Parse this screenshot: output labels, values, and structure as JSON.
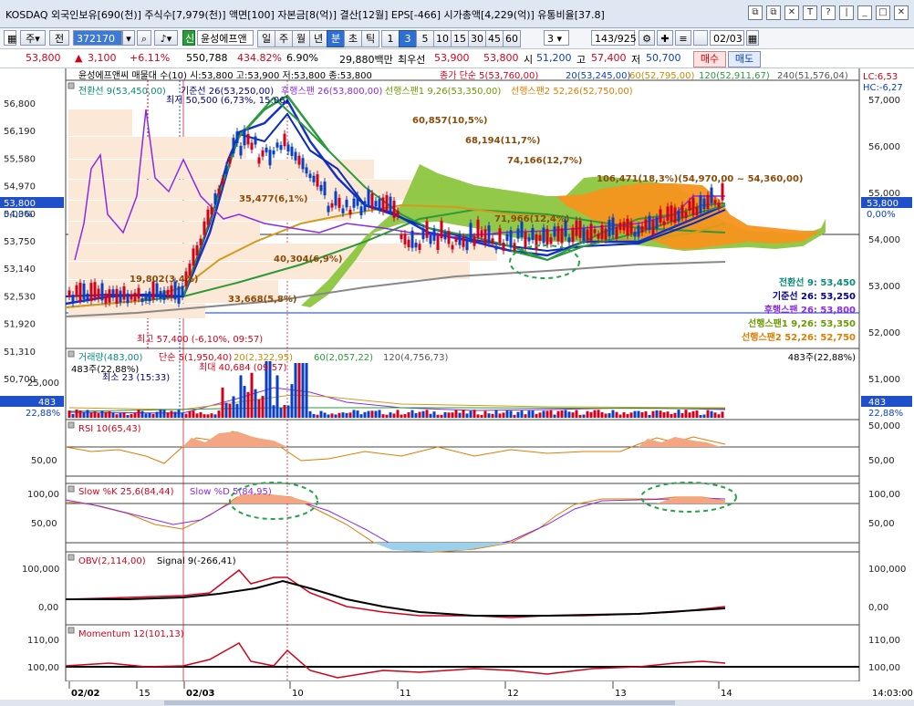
{
  "title_bar": {
    "text": "KOSDAQ 외국인보유[690(천)] 주식수[7,979(천)] 액면[100] 자본금[8(억)] 결산[12월] EPS[-466] 시가총액[4,229(억)] 유통비율[37.8]",
    "icons": [
      "restore-icon",
      "copy-icon",
      "close-icon",
      "text-icon",
      "help-icon",
      "bars-icon",
      "minimize-icon",
      "window-icon",
      "close-x-icon"
    ],
    "glyphs": [
      "⧉",
      "⧉",
      "✕",
      "T",
      "?",
      "|",
      "_",
      "□",
      "✕"
    ]
  },
  "toolbar": {
    "type_label": "주",
    "prefix_label": "전",
    "code": "372170",
    "market_badge": "신",
    "stock_name": "윤성에프앤",
    "period_buttons": [
      "일",
      "주",
      "월",
      "년",
      "분",
      "초",
      "틱"
    ],
    "active_period": "분",
    "interval_buttons": [
      "1",
      "3",
      "5",
      "10",
      "15",
      "30",
      "45",
      "60"
    ],
    "active_interval": "3",
    "count_value": "3",
    "page_display": "143/925",
    "date_value": "02/03"
  },
  "quote": {
    "price": "53,800",
    "change_arrow": "▲",
    "change": "3,100",
    "change_pct": "+6.11%",
    "volume": "550,788",
    "volume_ratio": "434.82%",
    "turnover": "6.90%",
    "amount": "29,880백만",
    "ask_label": "최우선",
    "ask": "53,900",
    "bid": "53,800",
    "open_label": "시",
    "open": "51,200",
    "high_label": "고",
    "high": "57,400",
    "low_label": "저",
    "low": "50,700",
    "buy_label": "매수",
    "sell_label": "매도"
  },
  "colors": {
    "up": "#d0021b",
    "down": "#0a3fc2",
    "ichimoku_fill_green": "#8cc63f",
    "ichimoku_fill_orange": "#f7941d",
    "volume_profile": "#fbe8d6"
  },
  "price_panel": {
    "header": "윤성에프앤씨 매물대 수(10)  시:53,800 고:53,900 저:53,800 종:53,800",
    "ma_legend": [
      "종가 단순 5(53,760,00)",
      "20(53,245,00)",
      "60(52,795,00)",
      "120(52,911,67)",
      "240(51,576,04)"
    ],
    "ichimoku_legend": [
      "전환선 9(53,450,00)",
      "기준선 26(53,250,00)",
      "후행스팬 26(53,800,00)",
      "선행스팬1 9,26(53,350,00)",
      "선행스팬2 52,26(52,750,00)"
    ],
    "lc": "LC:6,53",
    "hc": "HC:-6,27",
    "y_ticks": [
      "56,800",
      "56,190",
      "55,580",
      "54,970",
      "54,360",
      "53,750",
      "53,140",
      "52,530",
      "51,920",
      "51,310",
      "50,700"
    ],
    "right_ticks": [
      "57,000",
      "56,000",
      "55,000",
      "54,000",
      "53,000",
      "52,000",
      "51,000",
      "50,000"
    ],
    "current_left": "53,800",
    "current_pct_left": "0,00%",
    "current_right": "53,800",
    "current_pct_right": "0,00%",
    "annotations": {
      "low_mark": "최저 50,500 (6,73%, 15:06)",
      "high_mark": "최고 57,400 (-6,10%, 09:57)",
      "vp1": "60,857(10,5%)",
      "vp2": "68,194(11,7%)",
      "vp3": "74,166(12,7%)",
      "vp4": "106,471(18,3%)(54,970,00 ~ 54,360,00)",
      "vp5": "35,477(6,1%)",
      "vp6": "71,966(12,4%)",
      "vp7": "40,304(6,9%)",
      "vp8": "19,802(3,4%)",
      "vp9": "33,668(5,8%)"
    },
    "right_legend": [
      {
        "text": "전환선 9: 53,450",
        "color": "#0a8a7a"
      },
      {
        "text": "기준선 26: 53,250",
        "color": "#00008b"
      },
      {
        "text": "후행스팬 26: 53,800",
        "color": "#8a2be2"
      },
      {
        "text": "선행스팬1 9,26: 53,350",
        "color": "#6a9a00"
      },
      {
        "text": "선행스팬2 52,26: 52,750",
        "color": "#e07b00"
      }
    ]
  },
  "volume_panel": {
    "header": "거래량(483,00)",
    "ma_legend": [
      "단순 5(1,950,40)",
      "20(2,322,95)",
      "60(2,057,22)",
      "120(4,756,73)"
    ],
    "right_info": "483주(22,88%)",
    "left_info": "483주(22,88%)",
    "max_mark": "최대 40,684 (09:57)",
    "min_mark": "최소 23 (15:33)",
    "tick": "25,000",
    "current_left": "483",
    "current_pct_left": "22,88%",
    "current_right": "483",
    "current_pct_right": "22,88%"
  },
  "rsi_panel": {
    "header": "RSI 10(65,43)",
    "tick": "50,00"
  },
  "stoch_panel": {
    "header_k": "Slow %K 25,6(84,44)",
    "header_d": "Slow %D 5(84,95)",
    "ticks": [
      "100,00",
      "50,00"
    ]
  },
  "obv_panel": {
    "header": "OBV(2,114,00)",
    "signal": "Signal 9(-266,41)",
    "ticks": [
      "100,000",
      "0,00"
    ]
  },
  "mom_panel": {
    "header": "Momentum 12(101,13)",
    "ticks": [
      "110,00",
      "100,00"
    ]
  },
  "x_axis": {
    "labels": [
      "02/02",
      "15",
      "02/03",
      "10",
      "11",
      "12",
      "13",
      "14"
    ],
    "time": "14:03:00"
  }
}
